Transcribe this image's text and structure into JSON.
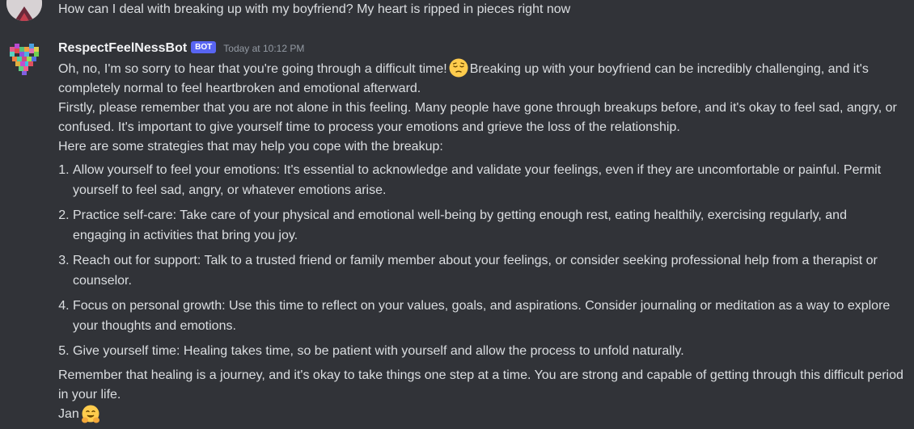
{
  "user_message": {
    "text": "How can I deal with breaking up with my boyfriend? My heart is ripped in pieces right now"
  },
  "bot_message": {
    "username": "RespectFeelNessBot",
    "tag": "BOT",
    "timestamp": "Today at 10:12 PM",
    "intro_line_1": "Oh, no, I'm so sorry to hear that you're going through a difficult time!",
    "intro_emoji": "pensive-face-emoji",
    "intro_line_2": "Breaking up with your boyfriend can be incredibly challenging, and it's completely normal to feel heartbroken and emotional afterward.",
    "paragraph_2": "Firstly, please remember that you are not alone in this feeling. Many people have gone through breakups before, and it's okay to feel sad, angry, or confused. It's important to give yourself time to process your emotions and grieve the loss of the relationship.",
    "paragraph_3": "Here are some strategies that may help you cope with the breakup:",
    "list_items": [
      "Allow yourself to feel your emotions: It's essential to acknowledge and validate your feelings, even if they are uncomfortable or painful. Permit yourself to feel sad, angry, or whatever emotions arise.",
      "Practice self-care: Take care of your physical and emotional well-being by getting enough rest, eating healthily, exercising regularly, and engaging in activities that bring you joy.",
      "Reach out for support: Talk to a trusted friend or family member about your feelings, or consider seeking professional help from a therapist or counselor.",
      "Focus on personal growth: Use this time to reflect on your values, goals, and aspirations. Consider journaling or meditation as a way to explore your thoughts and emotions.",
      "Give yourself time: Healing takes time, so be patient with yourself and allow the process to unfold naturally."
    ],
    "closing": "Remember that healing is a journey, and it's okay to take things one step at a time. You are strong and capable of getting through this difficult period in your life.",
    "signature": "Jan",
    "signature_emoji": "hugging-face-emoji"
  },
  "colors": {
    "background": "#313338",
    "text": "#dbdee1",
    "username": "#f2f3f5",
    "bot_tag": "#5865f2",
    "timestamp": "#949ba4"
  }
}
